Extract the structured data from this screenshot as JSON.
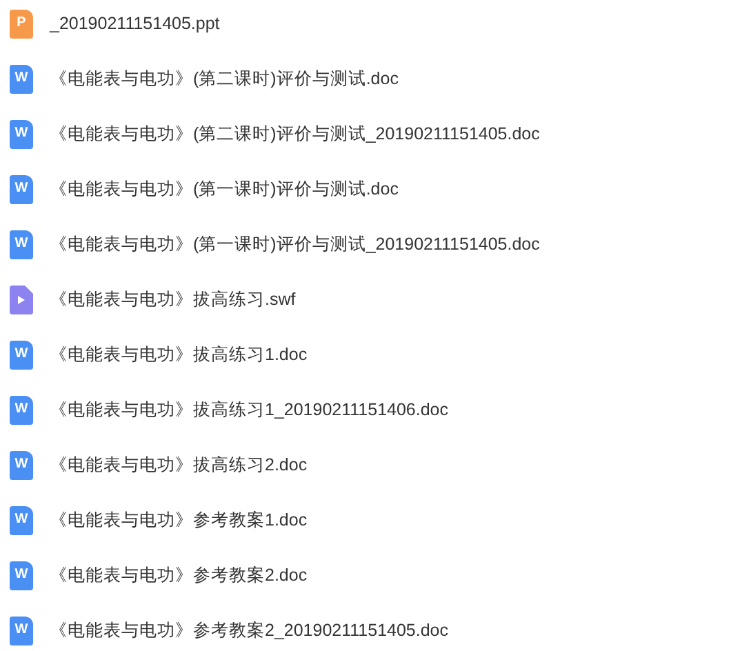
{
  "files": [
    {
      "kind": "ppt",
      "icon_letter": "P",
      "name": "_20190211151405.ppt"
    },
    {
      "kind": "doc",
      "icon_letter": "W",
      "name": "《电能表与电功》(第二课时)评价与测试.doc"
    },
    {
      "kind": "doc",
      "icon_letter": "W",
      "name": "《电能表与电功》(第二课时)评价与测试_20190211151405.doc"
    },
    {
      "kind": "doc",
      "icon_letter": "W",
      "name": "《电能表与电功》(第一课时)评价与测试.doc"
    },
    {
      "kind": "doc",
      "icon_letter": "W",
      "name": "《电能表与电功》(第一课时)评价与测试_20190211151405.doc"
    },
    {
      "kind": "swf",
      "name": "《电能表与电功》拔高练习.swf"
    },
    {
      "kind": "doc",
      "icon_letter": "W",
      "name": "《电能表与电功》拔高练习1.doc"
    },
    {
      "kind": "doc",
      "icon_letter": "W",
      "name": "《电能表与电功》拔高练习1_20190211151406.doc"
    },
    {
      "kind": "doc",
      "icon_letter": "W",
      "name": "《电能表与电功》拔高练习2.doc"
    },
    {
      "kind": "doc",
      "icon_letter": "W",
      "name": "《电能表与电功》参考教案1.doc"
    },
    {
      "kind": "doc",
      "icon_letter": "W",
      "name": "《电能表与电功》参考教案2.doc"
    },
    {
      "kind": "doc",
      "icon_letter": "W",
      "name": "《电能表与电功》参考教案2_20190211151405.doc"
    }
  ]
}
